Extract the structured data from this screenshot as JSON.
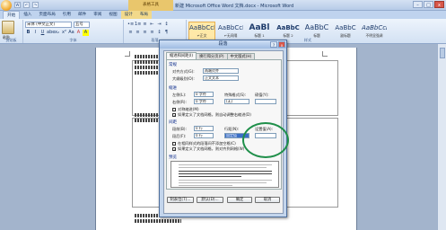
{
  "window": {
    "title": "新建 Microsoft Office Word 文档.docx - Microsoft Word",
    "tool_tab_title": "表格工具",
    "controls": [
      "–",
      "□",
      "x"
    ]
  },
  "qat": [
    "W",
    "↶",
    "↷"
  ],
  "ribbon_tabs": [
    "开始",
    "插入",
    "页面布局",
    "引用",
    "邮件",
    "审阅",
    "视图",
    "设计",
    "布局"
  ],
  "ribbon": {
    "paste": "粘贴",
    "clipboard": "剪贴板",
    "font_name": "宋体 (中文正文)",
    "font_size": "五号",
    "font_group": "字体",
    "paragraph_group": "段落",
    "styles_group": "样式",
    "format_buttons": [
      "B",
      "I",
      "U",
      "abe",
      "x₂",
      "x²",
      "Aa",
      "A",
      "A"
    ],
    "para_buttons": [
      "≡",
      "≡",
      "≡",
      "≡",
      "↕",
      "¶"
    ],
    "styles": [
      {
        "preview": "AaBbCcDd",
        "name": "↵正文"
      },
      {
        "preview": "AaBbCcDd",
        "name": "↵无间隔"
      },
      {
        "preview": "AaBl",
        "name": "标题 1"
      },
      {
        "preview": "AaBbC",
        "name": "标题 2"
      },
      {
        "preview": "AaBbC",
        "name": "标题"
      },
      {
        "preview": "AaBbC",
        "name": "副标题"
      },
      {
        "preview": "AaBbCcDd",
        "name": "不明显强调"
      }
    ]
  },
  "dialog": {
    "title": "段落",
    "controls": [
      "?",
      "x"
    ],
    "tabs": [
      "缩进和间距(I)",
      "换行和分页(P)",
      "中文版式(H)"
    ],
    "general": {
      "heading": "常规",
      "alignment_label": "对齐方式(G):",
      "alignment_value": "两端对齐",
      "outline_label": "大纲级别(O):",
      "outline_value": "正文文本"
    },
    "indent": {
      "heading": "缩进",
      "left_label": "左侧(L):",
      "left_value": "0 字符",
      "right_label": "右侧(R):",
      "right_value": "0 字符",
      "special_label": "特殊格式(S):",
      "special_value": "(无)",
      "by_label": "磅值(Y):",
      "mirror_label": "对称缩进(M)",
      "auto_adjust_label": "如果定义了文档网格，则自动调整右缩进(D)"
    },
    "spacing": {
      "heading": "间距",
      "before_label": "段前(B):",
      "before_value": "0 行",
      "after_label": "段后(F):",
      "after_value": "0 行",
      "line_label": "行距(N):",
      "line_value": "固定值",
      "at_label": "设置值(A):",
      "at_value": "",
      "no_space_label": "在相同样式的段落间不添加空格(C)",
      "snap_label": "如果定义了文档网格，则对齐到网格(W)"
    },
    "preview_heading": "预览",
    "buttons": [
      "制表位(T)...",
      "默认(D)...",
      "确定",
      "取消"
    ]
  }
}
